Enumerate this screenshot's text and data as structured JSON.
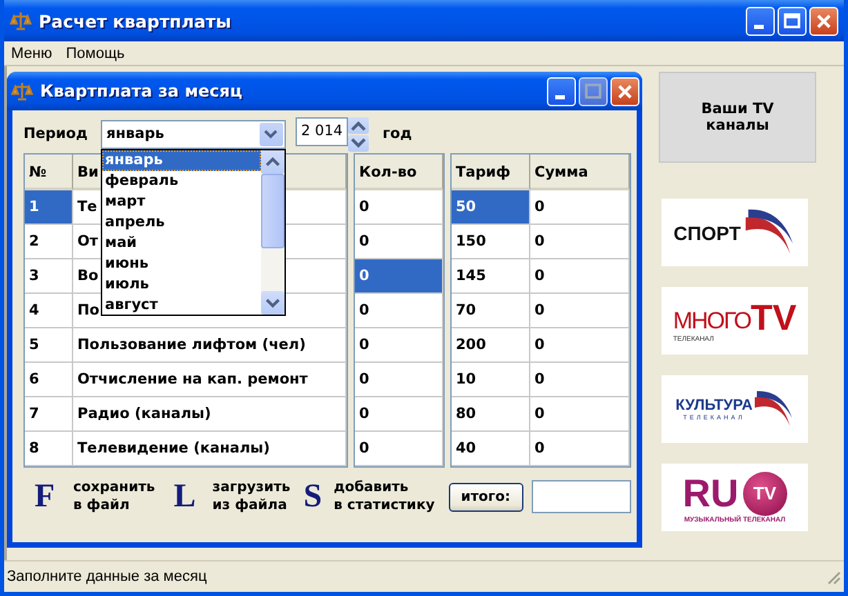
{
  "window": {
    "title": "Расчет квартплаты"
  },
  "menu": [
    "Меню",
    "Помощь"
  ],
  "child_window": {
    "title": "Квартплата за месяц",
    "period": {
      "label": "Период",
      "value": "январь",
      "year": "2 014",
      "year_label": "год",
      "dropdown": [
        {
          "label": "январь",
          "selected": true
        },
        {
          "label": "февраль",
          "selected": false
        },
        {
          "label": "март",
          "selected": false
        },
        {
          "label": "апрель",
          "selected": false
        },
        {
          "label": "май",
          "selected": false
        },
        {
          "label": "июнь",
          "selected": false
        },
        {
          "label": "июль",
          "selected": false
        },
        {
          "label": "август",
          "selected": false
        }
      ]
    },
    "tables": [
      {
        "columns": [
          "№",
          "Ви"
        ],
        "rows": [
          [
            {
              "text": "1",
              "selected": true
            },
            {
              "text": "Те",
              "selected": false
            }
          ],
          [
            {
              "text": "2",
              "selected": false
            },
            {
              "text": "От",
              "selected": false
            }
          ],
          [
            {
              "text": "3",
              "selected": false
            },
            {
              "text": "Во",
              "selected": false
            }
          ],
          [
            {
              "text": "4",
              "selected": false
            },
            {
              "text": "По",
              "selected": false
            }
          ],
          [
            {
              "text": "5",
              "selected": false
            },
            {
              "text": "Пользование лифтом (чел)",
              "selected": false
            }
          ],
          [
            {
              "text": "6",
              "selected": false
            },
            {
              "text": "Отчисление на кап. ремонт",
              "selected": false
            }
          ],
          [
            {
              "text": "7",
              "selected": false
            },
            {
              "text": "Радио (каналы)",
              "selected": false
            }
          ],
          [
            {
              "text": "8",
              "selected": false
            },
            {
              "text": "Телевидение (каналы)",
              "selected": false
            }
          ]
        ]
      },
      {
        "columns": [
          "Кол-во"
        ],
        "rows": [
          [
            {
              "text": "0",
              "selected": false
            }
          ],
          [
            {
              "text": "0",
              "selected": false
            }
          ],
          [
            {
              "text": "0",
              "selected": true
            }
          ],
          [
            {
              "text": "0",
              "selected": false
            }
          ],
          [
            {
              "text": "0",
              "selected": false
            }
          ],
          [
            {
              "text": "0",
              "selected": false
            }
          ],
          [
            {
              "text": "0",
              "selected": false
            }
          ],
          [
            {
              "text": "0",
              "selected": false
            }
          ]
        ]
      },
      {
        "columns": [
          "Тариф",
          "Сумма"
        ],
        "rows": [
          [
            {
              "text": "50",
              "selected": true
            },
            {
              "text": "0",
              "selected": false
            }
          ],
          [
            {
              "text": "150",
              "selected": false
            },
            {
              "text": "0",
              "selected": false
            }
          ],
          [
            {
              "text": "145",
              "selected": false
            },
            {
              "text": "0",
              "selected": false
            }
          ],
          [
            {
              "text": "70",
              "selected": false
            },
            {
              "text": "0",
              "selected": false
            }
          ],
          [
            {
              "text": "200",
              "selected": false
            },
            {
              "text": "0",
              "selected": false
            }
          ],
          [
            {
              "text": "10",
              "selected": false
            },
            {
              "text": "0",
              "selected": false
            }
          ],
          [
            {
              "text": "80",
              "selected": false
            },
            {
              "text": "0",
              "selected": false
            }
          ],
          [
            {
              "text": "40",
              "selected": false
            },
            {
              "text": "0",
              "selected": false
            }
          ]
        ]
      }
    ],
    "actions": [
      {
        "key": "F",
        "line1": "сохранить",
        "line2": "в файл"
      },
      {
        "key": "L",
        "line1": "загрузить",
        "line2": "из файла"
      },
      {
        "key": "S",
        "line1": "добавить",
        "line2": "в статистику"
      }
    ],
    "total_button": "итого:"
  },
  "channels_button": "Ваши TV  каналы",
  "logos": [
    {
      "kind": "sport",
      "texts": [
        "СПОРТ"
      ]
    },
    {
      "kind": "mnogo",
      "texts": [
        "МНОГО",
        "TV",
        "ТЕЛЕКАНАЛ"
      ]
    },
    {
      "kind": "kultura",
      "texts": [
        "КУЛЬТУРА",
        "ТЕЛЕКАНАЛ"
      ]
    },
    {
      "kind": "rutv",
      "texts": [
        "RU",
        "TV",
        "МУЗЫКАЛЬНЫЙ ТЕЛЕКАНАЛ"
      ]
    }
  ],
  "status_bar": "Заполните данные за месяц"
}
